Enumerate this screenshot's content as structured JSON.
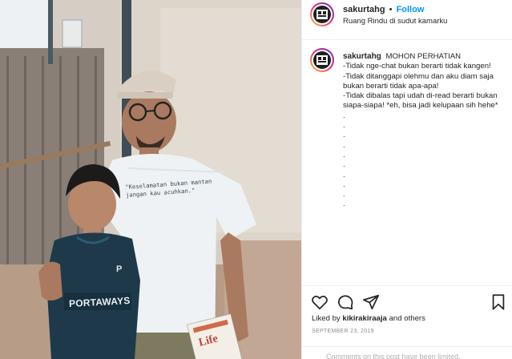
{
  "post": {
    "username": "sakurtahg",
    "follow_label": "Follow",
    "separator": "•",
    "location": "Ruang Rindu di sudut kamarku"
  },
  "photo": {
    "shirt_text": "\"Keselamatan bukan mantan jangan kau acuhkan.\"",
    "jersey_text": "PORTAWAYS",
    "jersey_badge": "P",
    "book_text": "Life"
  },
  "caption": {
    "username": "sakurtahg",
    "lines": [
      "MOHON PERHATIAN",
      "-Tidak nge-chat bukan berarti tidak kangen!",
      "-Tidak ditanggapi olehmu dan aku diam saja bukan berarti tidak apa-apa!",
      "-Tidak dibalas tapi udah di-read berarti bukan siapa-siapa! *eh, bisa jadi kelupaan sih hehe*"
    ],
    "dots": [
      ".",
      ".",
      ".",
      ".",
      ".",
      ".",
      ".",
      ".",
      ".",
      "."
    ]
  },
  "actions": {
    "like_icon": "heart-icon",
    "comment_icon": "comment-icon",
    "share_icon": "share-icon",
    "save_icon": "bookmark-icon"
  },
  "likes": {
    "prefix": "Liked by",
    "user": "kikirakiraaja",
    "suffix": "and others"
  },
  "date": "SEPTEMBER 23, 2019",
  "footer_text": "Comments on this post have been limited.",
  "colors": {
    "accent": "#0095f6",
    "text": "#262626",
    "muted": "#8e8e8e",
    "border": "#efefef"
  }
}
